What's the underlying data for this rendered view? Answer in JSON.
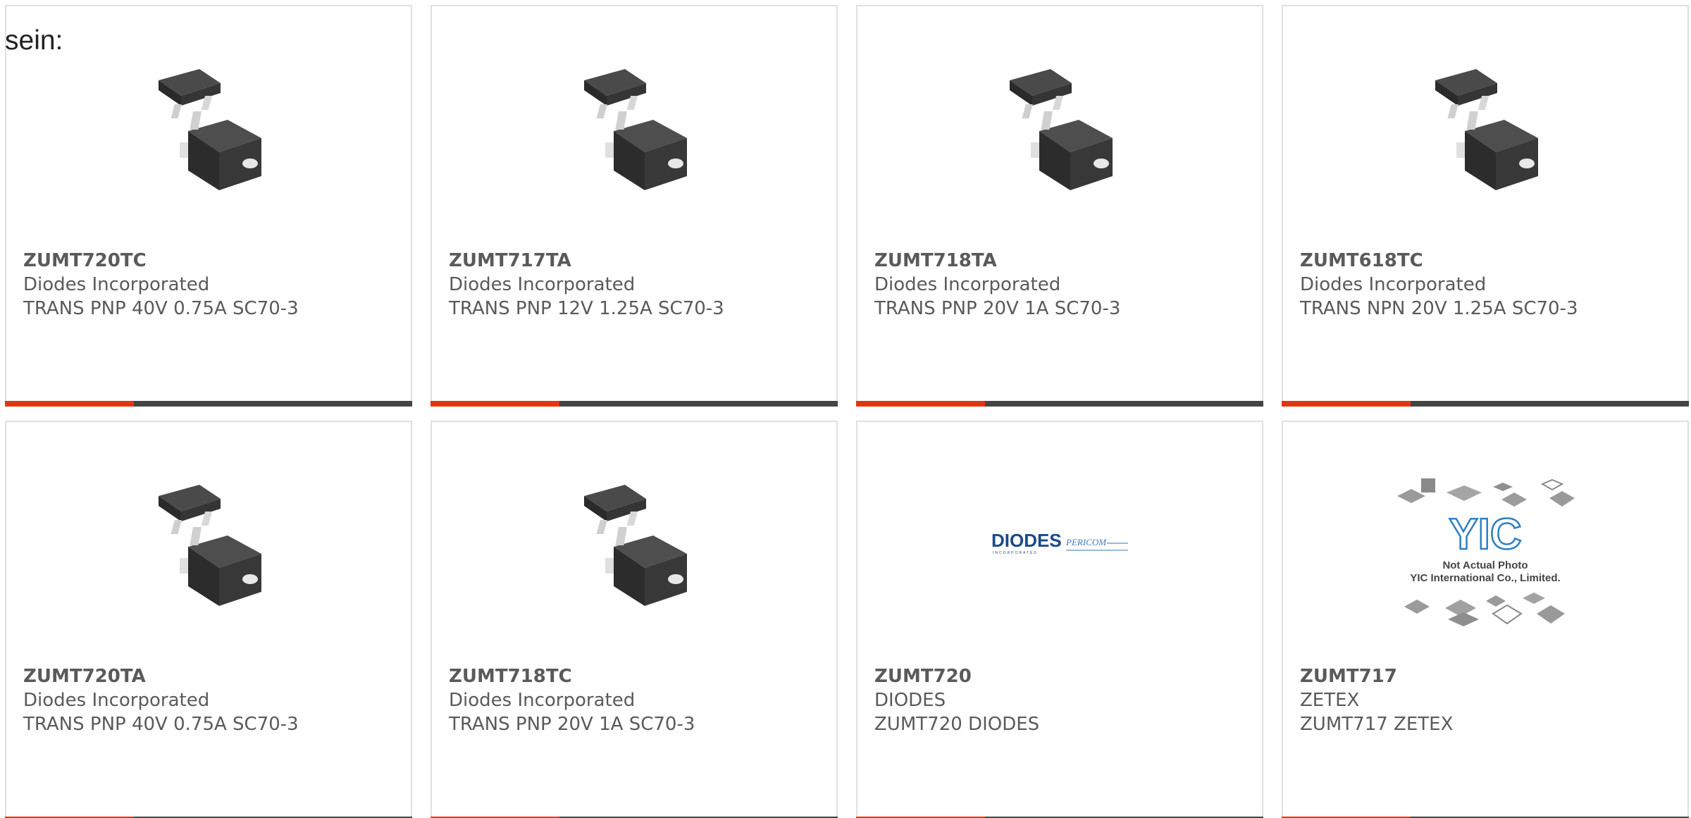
{
  "intro_text": "sein:",
  "colors": {
    "accent": "#e5350f",
    "bar": "#444444",
    "text": "#5a5a5a",
    "border": "#e0e0e0"
  },
  "products": [
    {
      "part_number": "ZUMT720TC",
      "manufacturer": "Diodes Incorporated",
      "description": "TRANS PNP 40V 0.75A SC70-3",
      "image": "sc70-3-package"
    },
    {
      "part_number": "ZUMT717TA",
      "manufacturer": "Diodes Incorporated",
      "description": "TRANS PNP 12V 1.25A SC70-3",
      "image": "sc70-3-package"
    },
    {
      "part_number": "ZUMT718TA",
      "manufacturer": "Diodes Incorporated",
      "description": "TRANS PNP 20V 1A SC70-3",
      "image": "sc70-3-package"
    },
    {
      "part_number": "ZUMT618TC",
      "manufacturer": "Diodes Incorporated",
      "description": "TRANS NPN 20V 1.25A SC70-3",
      "image": "sc70-3-package"
    },
    {
      "part_number": "ZUMT720TA",
      "manufacturer": "Diodes Incorporated",
      "description": "TRANS PNP 40V 0.75A SC70-3",
      "image": "sc70-3-package"
    },
    {
      "part_number": "ZUMT718TC",
      "manufacturer": "Diodes Incorporated",
      "description": "TRANS PNP 20V 1A SC70-3",
      "image": "sc70-3-package"
    },
    {
      "part_number": "ZUMT720",
      "manufacturer": "DIODES",
      "description": "ZUMT720 DIODES",
      "image": "diodes-logo",
      "logo_text": {
        "brand": "DIODES",
        "brand_sub": "INCORPORATED",
        "partner": "PERICOM"
      }
    },
    {
      "part_number": "ZUMT717",
      "manufacturer": "ZETEX",
      "description": "ZUMT717 ZETEX",
      "image": "yic-placeholder",
      "logo_text": {
        "brand": "YIC",
        "caption_1": "Not Actual Photo",
        "caption_2": "YIC International Co., Limited."
      }
    }
  ]
}
